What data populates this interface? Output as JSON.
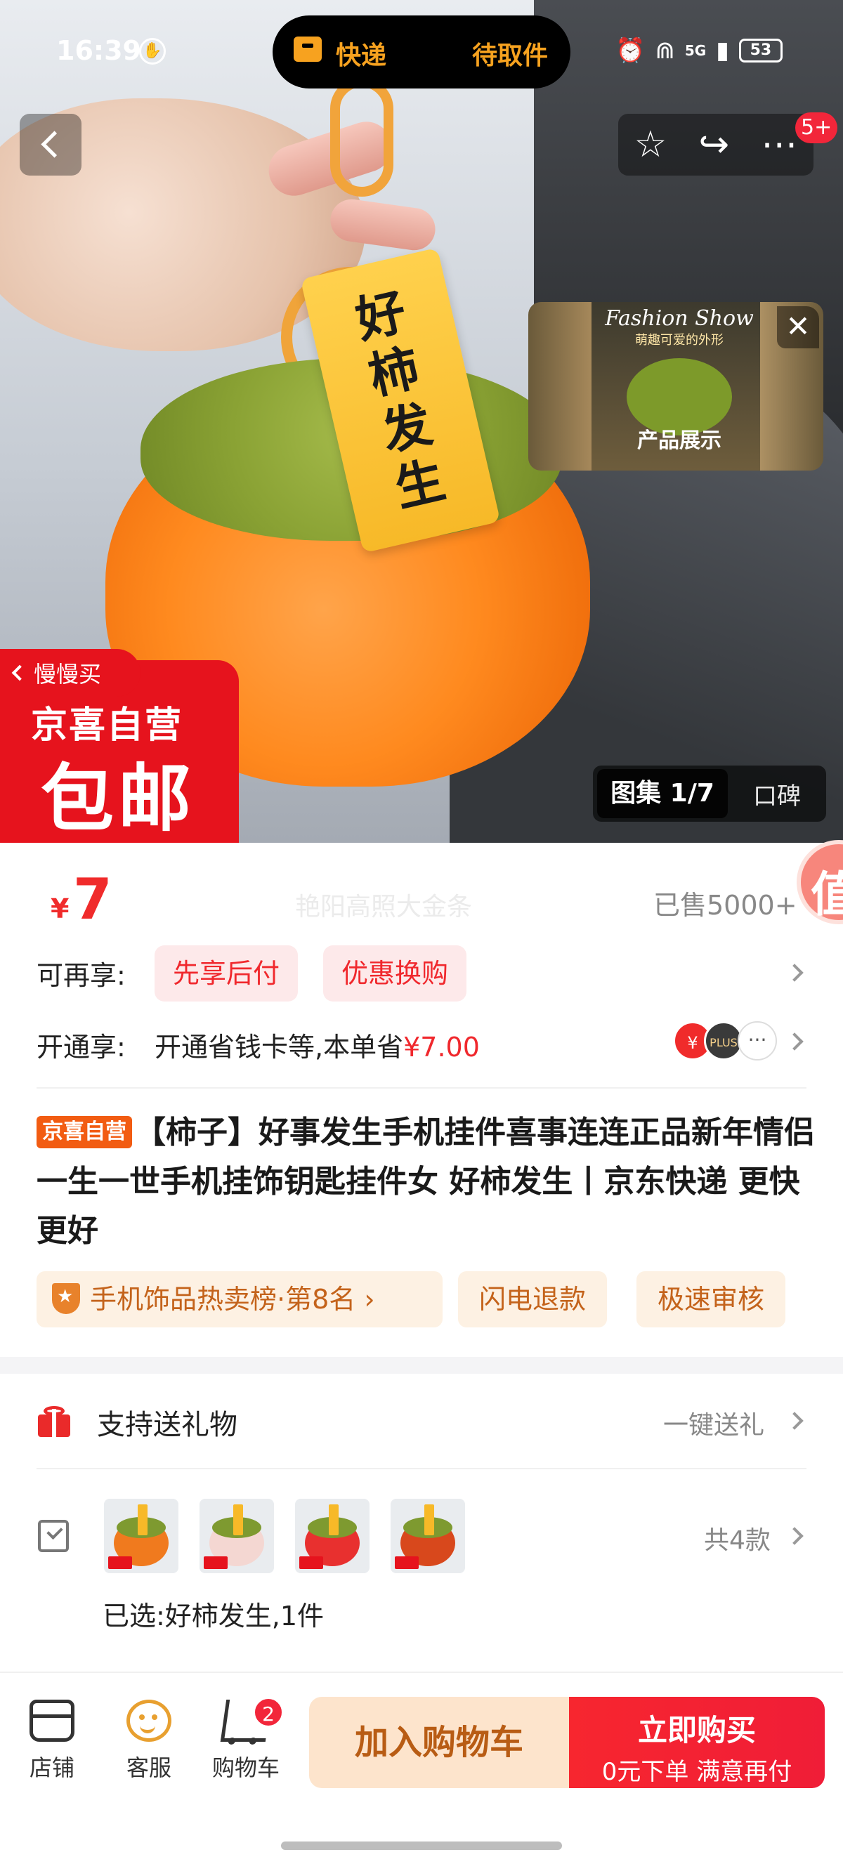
{
  "status_bar": {
    "time": "16:39",
    "network": "5G",
    "battery": "53",
    "island_left": "快递",
    "island_right": "待取件"
  },
  "header": {
    "action_badge": "5+"
  },
  "hero": {
    "tag_text": [
      "好",
      "柿",
      "发",
      "生"
    ],
    "float_video": {
      "title": "Fashion Show",
      "subtitle": "萌趣可爱的外形",
      "label": "产品展示"
    },
    "promo": {
      "slow_buy": "慢慢买",
      "brand": "京喜自营",
      "big": "包邮"
    },
    "gallery": {
      "active": "图集 1/7",
      "other": "口碑"
    }
  },
  "price": {
    "currency": "¥",
    "value": "7",
    "ghost_text": "艳阳高照大金条",
    "sold": "已售5000+",
    "side_badge": "值"
  },
  "benefits": {
    "label": "可再享:",
    "chips": [
      "先享后付",
      "优惠换购"
    ]
  },
  "membership": {
    "label": "开通享:",
    "text_prefix": "开通省钱卡等,本单省",
    "saving": "¥7.00",
    "icon1": "¥",
    "icon2": "PLUS",
    "icon3": "···"
  },
  "product": {
    "self_tag": "京喜自营",
    "title": "【柿子】好事发生手机挂件喜事连连正品新年情侣一生一世手机挂饰钥匙挂件女 好柿发生丨京东快递 更快更好",
    "rank": "手机饰品热卖榜·第8名",
    "chips": [
      "闪电退款",
      "极速审核"
    ]
  },
  "gift": {
    "text": "支持送礼物",
    "action": "一键送礼"
  },
  "variants": {
    "total": "共4款",
    "selected": "已选:好柿发生,1件"
  },
  "bottom": {
    "nav": [
      {
        "label": "店铺"
      },
      {
        "label": "客服"
      },
      {
        "label": "购物车"
      }
    ],
    "cart_count": "2",
    "add_to_cart": "加入购物车",
    "buy_now": "立即购买",
    "buy_sub": "0元下单 满意再付"
  },
  "colors": {
    "accent_red": "#f02b2b",
    "orange": "#f25c12",
    "cart_button": "#fde4cc"
  }
}
